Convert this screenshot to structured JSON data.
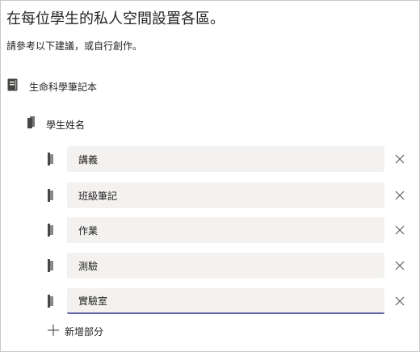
{
  "header": {
    "title": "在每位學生的私人空間設置各區。",
    "subtitle": "請參考以下建議，或自行創作。"
  },
  "notebook": {
    "icon": "notebook-icon",
    "label": "生命科學筆記本"
  },
  "section_group": {
    "icon": "section-group-icon",
    "label": "學生姓名"
  },
  "sections": [
    {
      "value": "講義",
      "icon": "section-icon",
      "remove_icon": "close-icon"
    },
    {
      "value": "班級筆記",
      "icon": "section-icon",
      "remove_icon": "close-icon"
    },
    {
      "value": "作業",
      "icon": "section-icon",
      "remove_icon": "close-icon"
    },
    {
      "value": "測驗",
      "icon": "section-icon",
      "remove_icon": "close-icon"
    },
    {
      "value": "實驗室",
      "icon": "section-icon",
      "remove_icon": "close-icon",
      "focused": true
    }
  ],
  "add_section": {
    "icon": "plus-icon",
    "label": "新增部分"
  },
  "colors": {
    "accent": "#6264a7",
    "field_bg": "#f3f2f1",
    "text": "#252423",
    "icon": "#484644"
  }
}
